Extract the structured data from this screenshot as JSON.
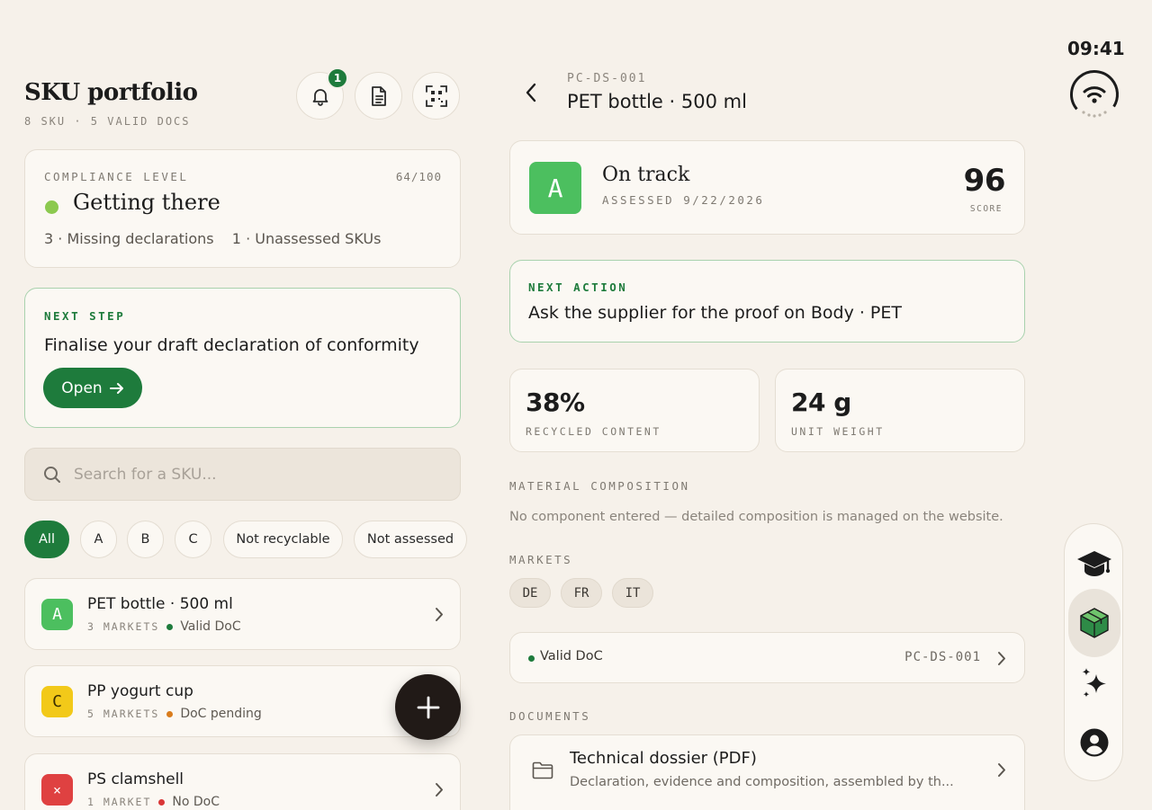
{
  "status": {
    "time": "09:41"
  },
  "portfolio": {
    "title": "SKU portfolio",
    "subtitle": "8 SKU · 5 VALID DOCS",
    "notification_count": "1"
  },
  "compliance": {
    "label": "COMPLIANCE LEVEL",
    "score": "64/100",
    "title": "Getting there",
    "missing": "3 · Missing declarations",
    "unassessed": "1 · Unassessed SKUs"
  },
  "next_step": {
    "label": "NEXT STEP",
    "text": "Finalise your draft declaration of conformity",
    "button": "Open"
  },
  "search": {
    "placeholder": "Search for a SKU..."
  },
  "filters": [
    "All",
    "A",
    "B",
    "C",
    "Not recyclable",
    "Not assessed"
  ],
  "skus": [
    {
      "grade": "A",
      "name": "PET bottle · 500 ml",
      "markets": "3 MARKETS",
      "doc": "Valid DoC",
      "doc_color": "#1e7b3c",
      "grade_bg": "#4cbf5f",
      "grade_fg": "#ffffff"
    },
    {
      "grade": "C",
      "name": "PP yogurt cup",
      "markets": "5 MARKETS",
      "doc": "DoC pending",
      "doc_color": "#d97c1c",
      "grade_bg": "#f2c919",
      "grade_fg": "#3b2f00"
    },
    {
      "grade": "×",
      "name": "PS clamshell",
      "markets": "1 MARKET",
      "doc": "No DoC",
      "doc_color": "#d93636",
      "grade_bg": "#df4141",
      "grade_fg": "#ffffff"
    }
  ],
  "detail": {
    "code": "PC-DS-001",
    "title": "PET bottle · 500 ml",
    "grade": "A",
    "status": "On track",
    "assessed": "ASSESSED 9/22/2026",
    "score": "96",
    "score_label": "SCORE",
    "next_action_label": "NEXT ACTION",
    "next_action": "Ask the supplier for the proof on Body · PET",
    "recycled": "38%",
    "recycled_label": "RECYCLED CONTENT",
    "weight": "24 g",
    "weight_label": "UNIT WEIGHT",
    "composition_label": "MATERIAL COMPOSITION",
    "composition_text": "No component entered — detailed composition is managed on the website.",
    "markets_label": "MARKETS",
    "markets": [
      "DE",
      "FR",
      "IT"
    ],
    "doc_status": "Valid DoC",
    "doc_code": "PC-DS-001",
    "documents_label": "DOCUMENTS",
    "document_title": "Technical dossier (PDF)",
    "document_desc": "Declaration, evidence and composition, assembled by th..."
  },
  "colors": {
    "accent": "#1e7b3c",
    "background": "#f6f1ea",
    "card": "#fbf8f3"
  }
}
